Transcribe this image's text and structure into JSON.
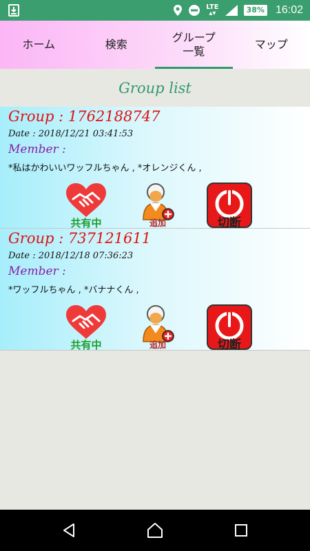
{
  "status_bar": {
    "time": "16:02",
    "battery": "38%",
    "network": "LTE"
  },
  "tabs": [
    {
      "label": "ホーム",
      "active": false
    },
    {
      "label": "検索",
      "active": false
    },
    {
      "label": "グループ\n一覧",
      "active": true
    },
    {
      "label": "マップ",
      "active": false
    }
  ],
  "page": {
    "title": "Group list"
  },
  "groups": [
    {
      "title": "Group : 1762188747",
      "date": "Date : 2018/12/21 03:41:53",
      "member_label": "Member :",
      "members": "*私はかわいいワッフルちゃん , *オレンジくん ,",
      "share_label": "共有中",
      "add_label": "追加",
      "disconnect_label": "切断"
    },
    {
      "title": "Group : 737121611",
      "date": "Date : 2018/12/18 07:36:23",
      "member_label": "Member :",
      "members": "*ワッフルちゃん , *バナナくん ,",
      "share_label": "共有中",
      "add_label": "追加",
      "disconnect_label": "切断"
    }
  ],
  "colors": {
    "accent": "#2e9a6c",
    "group_title": "#e01010",
    "member_label": "#8a1ea8"
  },
  "icons": {
    "share": "handshake-heart-icon",
    "add": "add-member-icon",
    "disconnect": "power-icon"
  }
}
